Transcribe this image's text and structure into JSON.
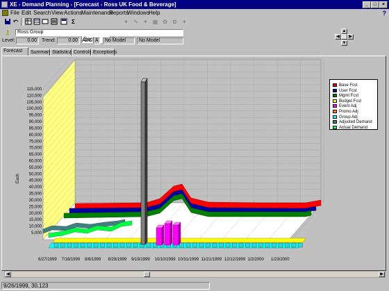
{
  "window": {
    "title": "XE - Demand Planning - [Forecast - Ross UK Food & Beverage]",
    "controls": {
      "minimize": "_",
      "maximize": "□",
      "close": "×"
    }
  },
  "menu": [
    "File",
    "Edit",
    "Search",
    "View",
    "Actions",
    "Maintenance",
    "Reports",
    "Windows",
    "Help"
  ],
  "help_glyph": "?",
  "toolbar": {
    "unit_select": "Each"
  },
  "entity": {
    "value": "Ross Group"
  },
  "stats": {
    "level_label": "Level:",
    "level_value": "0.00",
    "trend_label": "Trend:",
    "trend_value": "0.00",
    "abc_label": "ABC:",
    "abc_value": "A",
    "model1": "No Model",
    "model2": "No Model"
  },
  "tabs": [
    "Forecast",
    "Summary",
    "Statistical",
    "Controls",
    "Exceptions"
  ],
  "status": "9/26/1999, 30,123",
  "colors": {
    "wall": "#ffff80",
    "floor": "#ffffff",
    "grid": "#808080"
  },
  "chart_data": {
    "type": "area",
    "ylabel": "Each",
    "y_ticks": [
      "5,000",
      "10,000",
      "15,000",
      "20,000",
      "25,000",
      "30,000",
      "35,000",
      "40,000",
      "45,000",
      "50,000",
      "55,000",
      "60,000",
      "65,000",
      "70,000",
      "75,000",
      "80,000",
      "85,000",
      "90,000",
      "95,000",
      "100,000",
      "105,000",
      "110,000",
      "115,000"
    ],
    "x_ticks": [
      "6/27/1999",
      "7/18/1999",
      "8/8/1999",
      "8/29/1999",
      "9/19/1999",
      "10/10/1999",
      "10/31/1999",
      "11/21/1999",
      "12/12/1999",
      "1/2/2000",
      "1/23/2000"
    ],
    "ylim": [
      0,
      115000
    ],
    "legend_position": "right",
    "series": [
      {
        "name": "Base Fcst",
        "color": "#ff0000"
      },
      {
        "name": "User Fcst",
        "color": "#000080"
      },
      {
        "name": "Mgmt Fcst",
        "color": "#008000"
      },
      {
        "name": "Budget Fcst",
        "color": "#ffff00"
      },
      {
        "name": "Event Adj",
        "color": "#ff00ff"
      },
      {
        "name": "Promo Adj",
        "color": "#ff8000"
      },
      {
        "name": "Group Adj",
        "color": "#00ffff"
      },
      {
        "name": "Adjusted Demand",
        "color": "#408080"
      },
      {
        "name": "Actual Demand",
        "color": "#00ff40"
      }
    ],
    "forecast_level_approx": 32000,
    "event_adj_values": [
      20000,
      25000,
      22000
    ]
  }
}
